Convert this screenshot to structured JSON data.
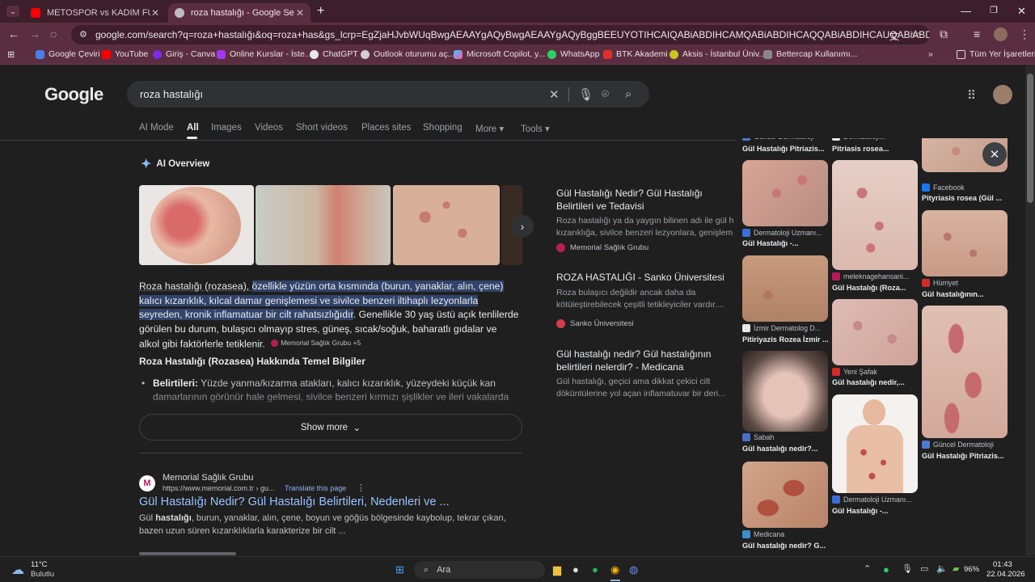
{
  "browser": {
    "tabs": [
      {
        "label": "METOSPOR vs KADIM FUTBOL",
        "favicon_color": "#ff0000"
      },
      {
        "label": "roza hastalığı - Google Search",
        "favicon_color": "#cccccc"
      }
    ],
    "new_tab": "+",
    "url": "google.com/search?q=roza+hastalığı&oq=roza+has&gs_lcrp=EgZjaHJvbWUqBwgAEAAYgAQyBwgAEAAYgAQyBggBEEUYOTIHCAIQABiABDIHCAMQABiABDIHCAQQABiABDIHCAUQABiABDIHCAYQABiABDIHCA...",
    "bookmarks": [
      "Google Çeviri",
      "YouTube",
      "Giriş - Canva",
      "Online Kurslar - İste...",
      "ChatGPT",
      "Outlook oturumu aç...",
      "Microsoft Copilot, y...",
      "WhatsApp",
      "BTK Akademi",
      "Aksis - İstanbul Üniv...",
      "Bettercap Kullanımı..."
    ],
    "bookmarks_more": "»",
    "all_bookmarks": "Tüm Yer İşaretleri"
  },
  "google": {
    "logo": "Google",
    "query": "roza hastalığı",
    "nav": [
      "AI Mode",
      "All",
      "Images",
      "Videos",
      "Short videos",
      "Places sites",
      "Shopping",
      "More",
      "Tools"
    ],
    "ai_overview_label": "AI Overview",
    "ai_text_plain1": "Roza hastalığı (rozasea), ",
    "ai_text_highlight": "özellikle yüzün orta kısmında (burun, yanaklar, alın, çene) kalıcı kızarıklık, kılcal damar genişlemesi ve sivilce benzeri iltihaplı lezyonlarla seyreden, kronik inflamatuar bir cilt rahatsızlığıdır",
    "ai_text_plain2": ". Genellikle 30 yaş üstü açık tenlilerde görülen bu durum, bulaşıcı olmayıp stres, güneş, sıcak/soğuk, baharatlı gıdalar ve alkol gibi faktörlerle tetiklenir.",
    "ai_source_chip": "Memorial Sağlık Grubu +5",
    "section_heading": "Roza Hastalığı (Rozasea) Hakkında Temel Bilgiler",
    "bullet_label": "Belirtileri:",
    "bullet_text": " Yüzde yanma/kızarma atakları, kalıcı kızarıklık, yüzeydeki küçük kan damarlarının görünür hale gelmesi, sivilce benzeri kırmızı şişlikler ve ileri vakalarda",
    "show_more": "Show more",
    "side_cards": [
      {
        "title": "Gül Hastalığı Nedir? Gül Hastalığı Belirtileri ve Tedavisi",
        "snippet1": "Roza hastalığı ya da yaygın bilinen adı ile gül h",
        "snippet2": "kızarıklığa, sivilce benzeri lezyonlara, genişlem",
        "source": "Memorial Sağlık Grubu",
        "color": "#b71c5a"
      },
      {
        "title": "ROZA HASTALIĞI - Sanko Üniversitesi",
        "snippet1": "Roza bulaşıcı değildir ancak daha da",
        "snippet2": "kötüleştirebilecek çeşitli tetikleyiciler vardır....",
        "source": "Sanko Üniversitesi",
        "color": "#d33b4d"
      },
      {
        "title": "Gül hastalığı nedir? Gül hastalığının belirtileri nelerdir? - Medicana",
        "snippet1": "Gül hastalığı, geçici ama dikkat çekici cilt",
        "snippet2": "döküntülerine yol açan inflamatuvar bir deri...",
        "source": "",
        "color": "#555555"
      }
    ],
    "result": {
      "source_name": "Memorial Sağlık Grubu",
      "url": "https://www.memorial.com.tr › gu...",
      "translate": "Translate this page",
      "title": "Gül Hastalığı Nedir? Gül Hastalığı Belirtileri, Nedenleri ve ...",
      "snippet_pre": "Gül ",
      "snippet_bold": "hastalığı",
      "snippet_post": ", burun, yanaklar, alın, çene, boyun ve göğüs bölgesinde kaybolup, tekrar çıkan, bazen uzun süren kızarıklıklarla karakterize bir cilt ..."
    }
  },
  "images_panel": {
    "col1": [
      {
        "src": "Güncel Dermatoloji",
        "title": "Gül Hastalığı Pitriazis...",
        "color": "#4a7bd0"
      },
      {
        "src": "Dermatoloji Uzmanı...",
        "title": "Gül Hastalığı -...",
        "color": "#3a6fd6"
      },
      {
        "src": "İzmir Dermatolog D...",
        "title": "Pitiriyazis Rozea İzmir ...",
        "color": "#e8e8e8"
      },
      {
        "src": "Sabah",
        "title": "Gül hastalığı nedir?...",
        "color": "#4b6cc9"
      },
      {
        "src": "Medicana",
        "title": "Gül hastalığı nedir? G...",
        "color": "#3a8fd0"
      }
    ],
    "col2": [
      {
        "src": "Dermatoloji...",
        "title": "Pitriasis rosea...",
        "color": "#e8e8e8"
      },
      {
        "src": "meleknagehansani...",
        "title": "Gül Hastalığı (Roza...",
        "color": "#b71c5a"
      },
      {
        "src": "Yeni Şafak",
        "title": "Gül hastalığı nedir,...",
        "color": "#d42a2a"
      },
      {
        "src": "Dermatoloji Uzmanı...",
        "title": "Gül Hastalığı -...",
        "color": "#3a6fd6"
      }
    ],
    "col3": [
      {
        "src": "Facebook",
        "title": "Pityriasis rosea (Gül ...",
        "color": "#1877f2"
      },
      {
        "src": "Hürriyet",
        "title": "Gül hastalığının...",
        "color": "#d42a2a"
      },
      {
        "src": "Güncel Dermatoloji",
        "title": "Gül Hastalığı Pitriazis...",
        "color": "#4a7bd0"
      }
    ],
    "close": "✕"
  },
  "taskbar": {
    "weather_temp": "11°C",
    "weather_text": "Bulutlu",
    "search_placeholder": "Ara",
    "battery": "96%",
    "time": "01:43",
    "date": "22.04.2026"
  }
}
